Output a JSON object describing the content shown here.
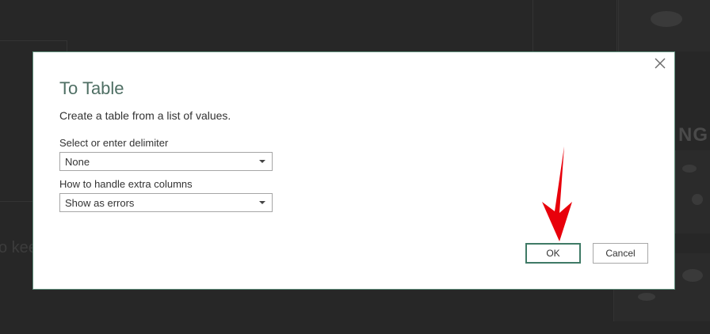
{
  "dialog": {
    "title": "To Table",
    "description": "Create a table from a list of values.",
    "close_icon": "close-icon",
    "delimiter": {
      "label": "Select or enter delimiter",
      "value": "None"
    },
    "extra_columns": {
      "label": "How to handle extra columns",
      "value": "Show as errors"
    },
    "ok_label": "OK",
    "cancel_label": "Cancel"
  },
  "background": {
    "fragment_left": "o kee",
    "fragment_right": "NG"
  },
  "colors": {
    "accent": "#3f7a66",
    "title": "#4f6f64",
    "overlay": "#272727",
    "annotation_arrow": "#e8000b"
  }
}
